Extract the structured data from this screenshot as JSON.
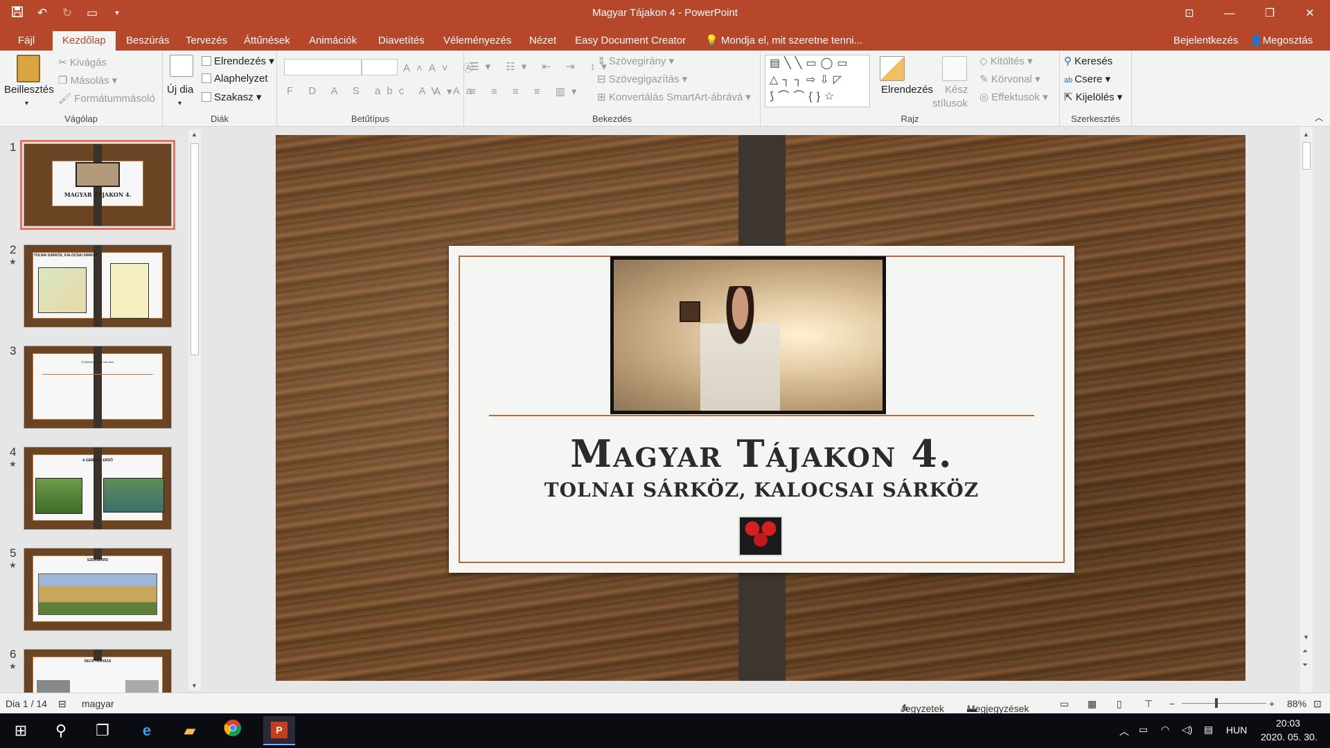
{
  "app": {
    "title": "Magyar Tájakon 4 - PowerPoint",
    "colors": {
      "accent": "#b7472a",
      "ribbon_bg": "#f3f3f3",
      "selection": "#e9705a"
    }
  },
  "quick_access": {
    "icons": [
      "save-icon",
      "undo-icon",
      "redo-icon",
      "present-icon",
      "customize-icon"
    ]
  },
  "tabs": [
    {
      "label": "Fájl"
    },
    {
      "label": "Kezdőlap"
    },
    {
      "label": "Beszúrás"
    },
    {
      "label": "Tervezés"
    },
    {
      "label": "Áttűnések"
    },
    {
      "label": "Animációk"
    },
    {
      "label": "Diavetítés"
    },
    {
      "label": "Véleményezés"
    },
    {
      "label": "Nézet"
    },
    {
      "label": "Easy Document Creator"
    }
  ],
  "active_tab": "Kezdőlap",
  "tell_me": "Mondja el, mit szeretne tenni...",
  "account": {
    "signin": "Bejelentkezés",
    "share": "Megosztás"
  },
  "ribbon": {
    "clipboard": {
      "label": "Vágólap",
      "paste": "Beillesztés",
      "cut": "Kivágás",
      "copy": "Másolás",
      "format_painter": "Formátummásoló"
    },
    "slides": {
      "label": "Diák",
      "new_slide": "Új dia",
      "layout": "Elrendezés",
      "reset": "Alaphelyzet",
      "section": "Szakasz"
    },
    "font": {
      "label": "Betűtípus"
    },
    "paragraph": {
      "label": "Bekezdés",
      "text_direction": "Szövegirány",
      "align_text": "Szövegigazítás",
      "smartart": "Konvertálás SmartArt-ábrává"
    },
    "drawing": {
      "label": "Rajz",
      "arrange": "Elrendezés",
      "quick_styles_1": "Kész",
      "quick_styles_2": "stílusok",
      "fill": "Kitöltés",
      "outline": "Körvonal",
      "effects": "Effektusok"
    },
    "editing": {
      "label": "Szerkesztés",
      "find": "Keresés",
      "replace": "Csere",
      "select": "Kijelölés"
    }
  },
  "thumbnails": [
    {
      "num": "1",
      "star": "",
      "title": "MAGYAR TÁJAKON 4."
    },
    {
      "num": "2",
      "star": "★",
      "title": "TOLNAI SÁRKÖZ, KALOCSAI SÁRKÖZ"
    },
    {
      "num": "3",
      "star": "",
      "title": "A Sárközről szóló dal címe"
    },
    {
      "num": "4",
      "star": "★",
      "title": "A GEMENCI ERDŐ"
    },
    {
      "num": "5",
      "star": "★",
      "title": "SZEKSZÁRD"
    },
    {
      "num": "6",
      "star": "★",
      "title": "DECS TÁJHÁZA"
    }
  ],
  "slide": {
    "title": "Magyar Tájakon 4.",
    "subtitle": "TOLNAI SÁRKÖZ, KALOCSAI SÁRKÖZ"
  },
  "status": {
    "slide_of": "Dia 1 / 14",
    "language": "magyar",
    "notes": "Jegyzetek",
    "comments": "Megjegyzések",
    "zoom": "88%"
  },
  "taskbar": {
    "lang": "HUN",
    "time": "20:03",
    "date": "2020. 05. 30."
  }
}
